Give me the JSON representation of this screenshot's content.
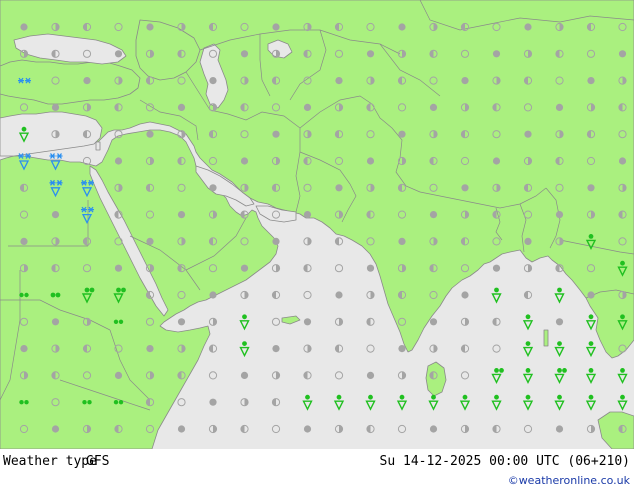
{
  "footer": {
    "title": "Weather type",
    "model": "GFS",
    "valid_time": "Su 14-12-2025 00:00 UTC (06+210)",
    "credit": "©weatheronline.co.uk"
  },
  "map": {
    "colors": {
      "land": "#aaf07f",
      "sea": "#e8e8e8",
      "border": "#8a8a8a",
      "coast": "#8a8a8a",
      "dot": "#a4a4a4",
      "snow": "#2b8ff0",
      "rain": "#20c020"
    },
    "symbols": [
      {
        "type": "snow",
        "col": 0,
        "row": 2
      },
      {
        "type": "shower-rain",
        "col": 0,
        "row": 4
      },
      {
        "type": "snow-shower",
        "col": 0,
        "row": 5
      },
      {
        "type": "snow-shower",
        "col": 1,
        "row": 5
      },
      {
        "type": "snow-shower",
        "col": 1,
        "row": 6
      },
      {
        "type": "snow-shower",
        "col": 2,
        "row": 6
      },
      {
        "type": "snow-shower",
        "col": 2,
        "row": 7
      },
      {
        "type": "rain-light",
        "col": 0,
        "row": 10
      },
      {
        "type": "rain",
        "col": 1,
        "row": 10
      },
      {
        "type": "rain-heavy",
        "col": 2,
        "row": 10
      },
      {
        "type": "rain-heavy",
        "col": 3,
        "row": 10
      },
      {
        "type": "rain-light",
        "col": 0,
        "row": 14
      },
      {
        "type": "rain-light",
        "col": 2,
        "row": 14
      },
      {
        "type": "rain-light",
        "col": 3,
        "row": 14
      },
      {
        "type": "rain-light",
        "col": 3,
        "row": 11
      },
      {
        "type": "snow",
        "col": 3,
        "row": 16
      },
      {
        "type": "shower-rain",
        "col": 12,
        "row": 18
      },
      {
        "type": "shower-rain",
        "col": 12,
        "row": 19
      },
      {
        "type": "shower-rain",
        "col": 15,
        "row": 10
      },
      {
        "type": "shower-rain",
        "col": 16,
        "row": 11
      },
      {
        "type": "shower-rain",
        "col": 16,
        "row": 12
      },
      {
        "type": "shower-rain",
        "col": 16,
        "row": 13
      },
      {
        "type": "shower-rain",
        "col": 17,
        "row": 12
      },
      {
        "type": "shower-rain",
        "col": 17,
        "row": 13
      },
      {
        "type": "shower-rain",
        "col": 17,
        "row": 14
      },
      {
        "type": "shower-rain",
        "col": 18,
        "row": 11
      },
      {
        "type": "shower-rain",
        "col": 18,
        "row": 12
      },
      {
        "type": "shower-rain",
        "col": 18,
        "row": 13
      },
      {
        "type": "shower-rain",
        "col": 19,
        "row": 11
      },
      {
        "type": "shower-rain",
        "col": 19,
        "row": 13
      },
      {
        "type": "shower-rain",
        "col": 12,
        "row": 14
      },
      {
        "type": "shower-rain",
        "col": 15,
        "row": 14
      },
      {
        "type": "rain-heavy",
        "col": 15,
        "row": 13
      },
      {
        "type": "shower-rain",
        "col": 16,
        "row": 14
      },
      {
        "type": "shower-rain",
        "col": 18,
        "row": 14
      },
      {
        "type": "shower-rain",
        "col": 19,
        "row": 14
      },
      {
        "type": "rain-heavy",
        "col": 17,
        "row": 13
      },
      {
        "type": "shower-rain",
        "col": 19,
        "row": 9
      },
      {
        "type": "shower-rain",
        "col": 17,
        "row": 10
      },
      {
        "type": "shower-rain",
        "col": 7,
        "row": 11
      },
      {
        "type": "shower-rain",
        "col": 9,
        "row": 14
      },
      {
        "type": "shower-rain",
        "col": 10,
        "row": 14
      },
      {
        "type": "shower-rain",
        "col": 11,
        "row": 14
      },
      {
        "type": "shower-rain",
        "col": 13,
        "row": 14
      },
      {
        "type": "shower-rain",
        "col": 14,
        "row": 14
      },
      {
        "type": "shower-rain",
        "col": 18,
        "row": 8
      },
      {
        "type": "shower-rain",
        "col": 7,
        "row": 12
      }
    ]
  }
}
